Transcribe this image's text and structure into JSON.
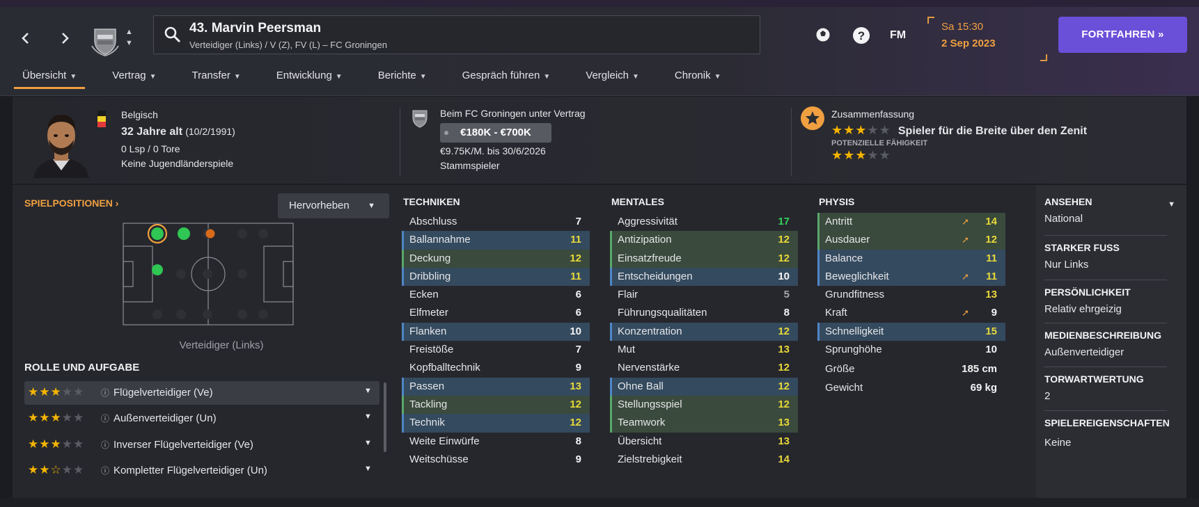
{
  "colors": {
    "accent": "#f0a040",
    "brand": "#6a4fd9",
    "blue_highlight": "#344a5e",
    "green_highlight": "#3a4a3c"
  },
  "header": {
    "player_title": "43. Marvin Peersman",
    "player_subtitle": "Verteidiger (Links) / V (Z), FV (L) – FC Groningen",
    "icons": [
      "chevron-left-icon",
      "chevron-right-icon",
      "club-crest-icon",
      "search-icon",
      "soccer-ball-icon",
      "help-icon",
      "fm-logo"
    ],
    "fm_label": "FM",
    "time": "Sa 15:30",
    "date": "2 Sep 2023",
    "continue_label": "FORTFAHREN »"
  },
  "menu": [
    "Übersicht",
    "Vertrag",
    "Transfer",
    "Entwicklung",
    "Berichte",
    "Gespräch führen",
    "Vergleich",
    "Chronik"
  ],
  "summary": {
    "nationality": "Belgisch",
    "age": "32 Jahre alt",
    "birthdate": "(10/2/1991)",
    "caps": "0 Lsp / 0 Tore",
    "youth_caps": "Keine Jugendländerspiele",
    "contract_club": "Beim FC Groningen unter Vertrag",
    "value_range": "€180K - €700K",
    "wage": "€9.75K/M. bis 30/6/2026",
    "squad_status": "Stammspieler",
    "summary_label": "Zusammenfassung",
    "summary_text": "Spieler für die Breite über den Zenit",
    "current_ability_stars": 3,
    "potential_label": "POTENZIELLE FÄHIGKEIT",
    "potential_ability_stars": 3
  },
  "positions": {
    "title": "SPIELPOSITIONEN ›",
    "highlight_label": "Hervorheben",
    "position_caption": "Verteidiger (Links)"
  },
  "roles": {
    "title": "ROLLE UND AUFGABE",
    "items": [
      {
        "name": "Flügelverteidiger (Ve)",
        "stars": 3
      },
      {
        "name": "Außenverteidiger (Un)",
        "stars": 3
      },
      {
        "name": "Inverser Flügelverteidiger (Ve)",
        "stars": 3
      },
      {
        "name": "Kompletter Flügelverteidiger (Un)",
        "stars": 2.5
      }
    ]
  },
  "technical": {
    "title": "TECHNIKEN",
    "items": [
      {
        "name": "Abschluss",
        "value": "7"
      },
      {
        "name": "Ballannahme",
        "value": "11"
      },
      {
        "name": "Deckung",
        "value": "12"
      },
      {
        "name": "Dribbling",
        "value": "11"
      },
      {
        "name": "Ecken",
        "value": "6"
      },
      {
        "name": "Elfmeter",
        "value": "6"
      },
      {
        "name": "Flanken",
        "value": "10"
      },
      {
        "name": "Freistöße",
        "value": "7"
      },
      {
        "name": "Kopfballtechnik",
        "value": "9"
      },
      {
        "name": "Passen",
        "value": "13"
      },
      {
        "name": "Tackling",
        "value": "12"
      },
      {
        "name": "Technik",
        "value": "12"
      },
      {
        "name": "Weite Einwürfe",
        "value": "8"
      },
      {
        "name": "Weitschüsse",
        "value": "9"
      }
    ]
  },
  "mental": {
    "title": "MENTALES",
    "items": [
      {
        "name": "Aggressivität",
        "value": "17"
      },
      {
        "name": "Antizipation",
        "value": "12"
      },
      {
        "name": "Einsatzfreude",
        "value": "12"
      },
      {
        "name": "Entscheidungen",
        "value": "10"
      },
      {
        "name": "Flair",
        "value": "5"
      },
      {
        "name": "Führungsqualitäten",
        "value": "8"
      },
      {
        "name": "Konzentration",
        "value": "12"
      },
      {
        "name": "Mut",
        "value": "13"
      },
      {
        "name": "Nervenstärke",
        "value": "12"
      },
      {
        "name": "Ohne Ball",
        "value": "12"
      },
      {
        "name": "Stellungsspiel",
        "value": "12"
      },
      {
        "name": "Teamwork",
        "value": "13"
      },
      {
        "name": "Übersicht",
        "value": "13"
      },
      {
        "name": "Zielstrebigkeit",
        "value": "14"
      }
    ]
  },
  "physical": {
    "title": "PHYSIS",
    "items": [
      {
        "name": "Antritt",
        "value": "14"
      },
      {
        "name": "Ausdauer",
        "value": "12"
      },
      {
        "name": "Balance",
        "value": "11"
      },
      {
        "name": "Beweglichkeit",
        "value": "11"
      },
      {
        "name": "Grundfitness",
        "value": "13"
      },
      {
        "name": "Kraft",
        "value": "9"
      },
      {
        "name": "Schnelligkeit",
        "value": "15"
      },
      {
        "name": "Sprunghöhe",
        "value": "10"
      }
    ],
    "height_label": "Größe",
    "height_value": "185 cm",
    "weight_label": "Gewicht",
    "weight_value": "69 kg"
  },
  "side": {
    "reputation_label": "ANSEHEN",
    "reputation_value": "National",
    "foot_label": "STARKER FUSS",
    "foot_value": "Nur Links",
    "personality_label": "PERSÖNLICHKEIT",
    "personality_value": "Relativ ehrgeizig",
    "media_label": "MEDIENBESCHREIBUNG",
    "media_value": "Außenverteidiger",
    "gk_label": "TORWARTWERTUNG",
    "gk_value": "2",
    "traits_label": "SPIELEREIGENSCHAFTEN",
    "traits_value": "Keine"
  }
}
